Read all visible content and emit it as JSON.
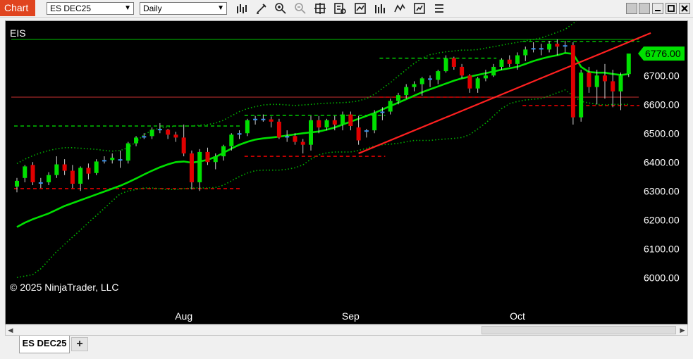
{
  "window": {
    "title": "Chart"
  },
  "toolbar": {
    "instrument": "ES DEC25",
    "interval": "Daily",
    "icons": [
      "bar-type-icon",
      "draw-tool-icon",
      "zoom-in-icon",
      "zoom-out-icon",
      "crosshair-icon",
      "data-box-icon",
      "strategies-icon",
      "indicators-icon",
      "templates-icon",
      "properties-icon",
      "more-icon"
    ]
  },
  "chart": {
    "instrument_label": "EIS",
    "copyright": "© 2025 NinjaTrader, LLC",
    "last_price_label": "6776.00",
    "colors": {
      "background": "#000000",
      "up": "#00e000",
      "down": "#e00000",
      "doji": "#3a8fe8",
      "sma": "#00e000",
      "bands": "#00b000",
      "hline_green": "#00c000",
      "hline_red": "#c83030",
      "trend": "#ff2020",
      "text": "#ffffff"
    }
  },
  "chart_data": {
    "type": "candlestick",
    "xlabels": [
      {
        "label": "Aug",
        "index": 21
      },
      {
        "label": "Sep",
        "index": 42
      },
      {
        "label": "Oct",
        "index": 63
      }
    ],
    "ylim": [
      5960,
      6920
    ],
    "yticks": [
      "6000.00",
      "6100.00",
      "6200.00",
      "6300.00",
      "6400.00",
      "6500.00",
      "6600.00",
      "6700.00"
    ],
    "yvalues": [
      6000,
      6100,
      6200,
      6300,
      6400,
      6500,
      6600,
      6700
    ],
    "hlines": [
      {
        "value": 6825,
        "color": "#00c000"
      },
      {
        "value": 6625,
        "color": "#c83030"
      }
    ],
    "trendline": [
      {
        "i": 43,
        "y": 6430
      },
      {
        "i": 78,
        "y": 6818
      }
    ],
    "dashed_levels": [
      {
        "i0": 0,
        "i1": 28,
        "y": 6525,
        "color": "#00c000"
      },
      {
        "i0": 0,
        "i1": 28,
        "y": 6308,
        "color": "#e00000"
      },
      {
        "i0": 29,
        "i1": 46,
        "y": 6562,
        "color": "#00c000"
      },
      {
        "i0": 29,
        "i1": 46,
        "y": 6420,
        "color": "#e00000"
      },
      {
        "i0": 46,
        "i1": 60,
        "y": 6760,
        "color": "#00c000"
      },
      {
        "i0": 46,
        "i1": 60,
        "y": 6625,
        "color": "#e00000"
      },
      {
        "i0": 64,
        "i1": 78,
        "y": 6818,
        "color": "#00c000"
      },
      {
        "i0": 64,
        "i1": 78,
        "y": 6596,
        "color": "#e00000"
      }
    ],
    "candles": [
      [
        6315,
        6345,
        6295,
        6335
      ],
      [
        6345,
        6390,
        6330,
        6385
      ],
      [
        6390,
        6400,
        6320,
        6330
      ],
      [
        6330,
        6345,
        6310,
        6325
      ],
      [
        6330,
        6365,
        6320,
        6355
      ],
      [
        6355,
        6420,
        6345,
        6392
      ],
      [
        6392,
        6410,
        6355,
        6370
      ],
      [
        6370,
        6390,
        6310,
        6325
      ],
      [
        6325,
        6385,
        6300,
        6380
      ],
      [
        6380,
        6395,
        6340,
        6360
      ],
      [
        6362,
        6410,
        6355,
        6402
      ],
      [
        6403,
        6420,
        6395,
        6407
      ],
      [
        6407,
        6430,
        6395,
        6415
      ],
      [
        6410,
        6440,
        6380,
        6405
      ],
      [
        6405,
        6470,
        6395,
        6465
      ],
      [
        6465,
        6490,
        6455,
        6485
      ],
      [
        6485,
        6500,
        6480,
        6490
      ],
      [
        6490,
        6520,
        6480,
        6512
      ],
      [
        6512,
        6535,
        6500,
        6515
      ],
      [
        6512,
        6515,
        6480,
        6495
      ],
      [
        6495,
        6505,
        6470,
        6485
      ],
      [
        6485,
        6530,
        6420,
        6430
      ],
      [
        6430,
        6440,
        6305,
        6330
      ],
      [
        6330,
        6445,
        6300,
        6435
      ],
      [
        6435,
        6450,
        6390,
        6400
      ],
      [
        6400,
        6430,
        6375,
        6420
      ],
      [
        6420,
        6460,
        6405,
        6455
      ],
      [
        6455,
        6500,
        6440,
        6495
      ],
      [
        6495,
        6510,
        6480,
        6500
      ],
      [
        6500,
        6550,
        6490,
        6545
      ],
      [
        6545,
        6560,
        6530,
        6550
      ],
      [
        6550,
        6565,
        6540,
        6548
      ],
      [
        6548,
        6558,
        6520,
        6540
      ],
      [
        6540,
        6550,
        6480,
        6485
      ],
      [
        6485,
        6510,
        6470,
        6490
      ],
      [
        6490,
        6500,
        6460,
        6470
      ],
      [
        6470,
        6480,
        6430,
        6460
      ],
      [
        6460,
        6560,
        6440,
        6545
      ],
      [
        6545,
        6560,
        6500,
        6520
      ],
      [
        6520,
        6550,
        6510,
        6545
      ],
      [
        6545,
        6560,
        6510,
        6530
      ],
      [
        6530,
        6575,
        6510,
        6565
      ],
      [
        6565,
        6575,
        6510,
        6525
      ],
      [
        6520,
        6560,
        6460,
        6475
      ],
      [
        6505,
        6515,
        6485,
        6510
      ],
      [
        6510,
        6580,
        6500,
        6570
      ],
      [
        6570,
        6590,
        6545,
        6575
      ],
      [
        6575,
        6620,
        6565,
        6612
      ],
      [
        6612,
        6640,
        6600,
        6632
      ],
      [
        6632,
        6670,
        6620,
        6660
      ],
      [
        6660,
        6680,
        6645,
        6670
      ],
      [
        6670,
        6695,
        6630,
        6690
      ],
      [
        6690,
        6700,
        6660,
        6685
      ],
      [
        6685,
        6720,
        6670,
        6715
      ],
      [
        6715,
        6770,
        6710,
        6760
      ],
      [
        6760,
        6765,
        6720,
        6730
      ],
      [
        6730,
        6740,
        6690,
        6700
      ],
      [
        6700,
        6705,
        6640,
        6655
      ],
      [
        6655,
        6695,
        6640,
        6690
      ],
      [
        6690,
        6720,
        6680,
        6700
      ],
      [
        6700,
        6740,
        6695,
        6730
      ],
      [
        6730,
        6760,
        6720,
        6755
      ],
      [
        6755,
        6770,
        6730,
        6740
      ],
      [
        6740,
        6780,
        6720,
        6770
      ],
      [
        6770,
        6800,
        6750,
        6790
      ],
      [
        6790,
        6815,
        6780,
        6795
      ],
      [
        6795,
        6810,
        6770,
        6790
      ],
      [
        6790,
        6820,
        6780,
        6810
      ],
      [
        6810,
        6825,
        6770,
        6800
      ],
      [
        6800,
        6820,
        6780,
        6805
      ],
      [
        6805,
        6815,
        6530,
        6555
      ],
      [
        6555,
        6720,
        6540,
        6710
      ],
      [
        6710,
        6730,
        6640,
        6660
      ],
      [
        6660,
        6720,
        6600,
        6700
      ],
      [
        6700,
        6740,
        6620,
        6680
      ],
      [
        6680,
        6720,
        6590,
        6645
      ],
      [
        6645,
        6710,
        6580,
        6700
      ],
      [
        6705,
        6775,
        6695,
        6776
      ]
    ],
    "sma": [
      6175,
      6190,
      6202,
      6212,
      6222,
      6235,
      6248,
      6258,
      6268,
      6278,
      6288,
      6298,
      6308,
      6318,
      6330,
      6343,
      6357,
      6370,
      6382,
      6392,
      6400,
      6402,
      6398,
      6402,
      6408,
      6418,
      6432,
      6447,
      6460,
      6470,
      6478,
      6482,
      6485,
      6488,
      6492,
      6496,
      6500,
      6503,
      6506,
      6512,
      6520,
      6530,
      6540,
      6550,
      6560,
      6570,
      6582,
      6594,
      6606,
      6618,
      6630,
      6642,
      6652,
      6662,
      6672,
      6682,
      6690,
      6696,
      6702,
      6708,
      6714,
      6720,
      6725,
      6730,
      6740,
      6750,
      6758,
      6765,
      6770,
      6778,
      6775,
      6730,
      6712,
      6710,
      6710,
      6705,
      6702,
      6705
    ],
    "upper_band": [
      6395,
      6410,
      6422,
      6432,
      6440,
      6446,
      6450,
      6450,
      6448,
      6446,
      6444,
      6440,
      6438,
      6440,
      6450,
      6470,
      6495,
      6510,
      6518,
      6522,
      6525,
      6525,
      6525,
      6528,
      6530,
      6535,
      6545,
      6560,
      6575,
      6585,
      6592,
      6598,
      6600,
      6600,
      6598,
      6596,
      6598,
      6600,
      6602,
      6604,
      6605,
      6606,
      6608,
      6612,
      6620,
      6635,
      6655,
      6675,
      6698,
      6720,
      6742,
      6760,
      6772,
      6778,
      6782,
      6785,
      6788,
      6788,
      6790,
      6795,
      6800,
      6805,
      6810,
      6815,
      6820,
      6825,
      6830,
      6840,
      6850,
      6860,
      6880,
      6905,
      6912,
      6912,
      6912,
      6912,
      6912,
      6912
    ],
    "lower_band": [
      6000,
      6005,
      6010,
      6030,
      6060,
      6090,
      6115,
      6140,
      6165,
      6190,
      6215,
      6240,
      6265,
      6290,
      6300,
      6305,
      6310,
      6310,
      6308,
      6305,
      6305,
      6308,
      6310,
      6310,
      6310,
      6312,
      6320,
      6335,
      6350,
      6362,
      6370,
      6372,
      6372,
      6372,
      6375,
      6380,
      6390,
      6410,
      6425,
      6432,
      6435,
      6435,
      6435,
      6440,
      6448,
      6455,
      6460,
      6462,
      6465,
      6470,
      6475,
      6475,
      6475,
      6478,
      6480,
      6482,
      6485,
      6495,
      6515,
      6535,
      6560,
      6585,
      6602,
      6610,
      6615,
      6618,
      6620,
      6630,
      6640,
      6650,
      6630,
      6610,
      6605,
      6600,
      6598,
      6600,
      6600,
      6600
    ]
  }
}
